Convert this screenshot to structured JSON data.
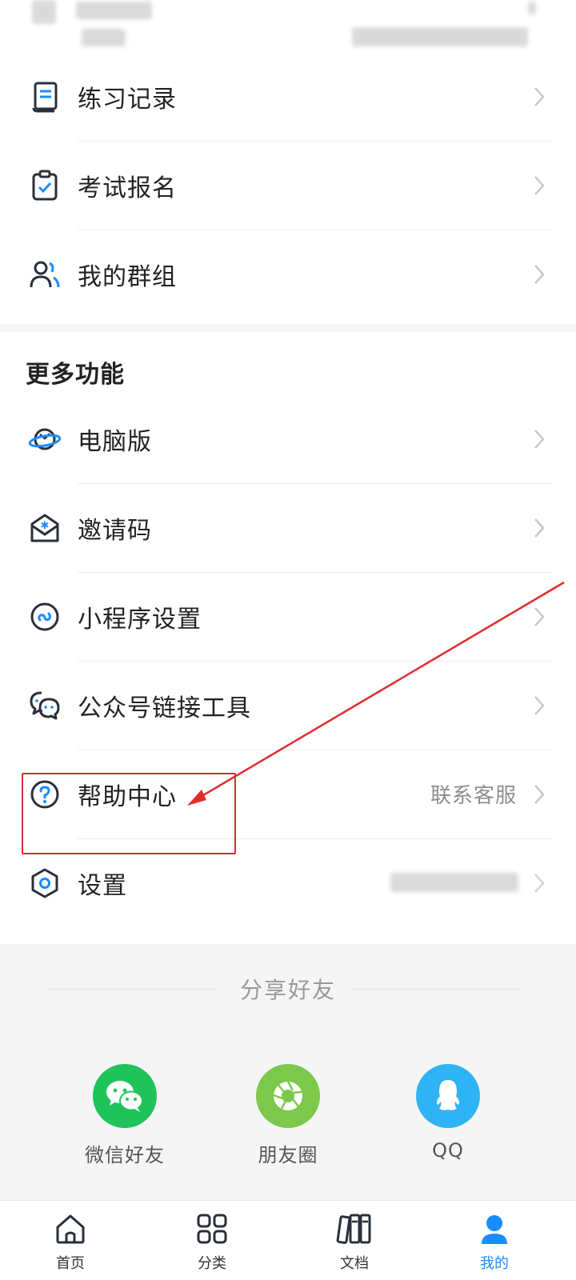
{
  "top_strip": {
    "note_hidden": ""
  },
  "menu_top": [
    {
      "name": "practice-records",
      "label": "练习记录",
      "icon": "document-icon"
    },
    {
      "name": "exam-registration",
      "label": "考试报名",
      "icon": "clipboard-check-icon"
    },
    {
      "name": "my-groups",
      "label": "我的群组",
      "icon": "group-icon"
    }
  ],
  "more_section": {
    "title": "更多功能",
    "items": [
      {
        "name": "desktop-version",
        "label": "电脑版",
        "icon": "planet-icon",
        "extra": ""
      },
      {
        "name": "invite-code",
        "label": "邀请码",
        "icon": "envelope-star-icon",
        "extra": ""
      },
      {
        "name": "mini-program-settings",
        "label": "小程序设置",
        "icon": "mini-program-icon",
        "extra": ""
      },
      {
        "name": "official-account-link-tool",
        "label": "公众号链接工具",
        "icon": "chat-bubbles-icon",
        "extra": ""
      },
      {
        "name": "help-center",
        "label": "帮助中心",
        "icon": "question-circle-icon",
        "extra": "联系客服"
      },
      {
        "name": "settings",
        "label": "设置",
        "icon": "hexagon-settings-icon",
        "extra": ""
      }
    ]
  },
  "share": {
    "title": "分享好友",
    "items": [
      {
        "name": "wechat-friends",
        "label": "微信好友",
        "color": "#1fc35a",
        "icon": "wechat-icon"
      },
      {
        "name": "moments",
        "label": "朋友圈",
        "color": "#7cc84b",
        "icon": "moments-aperture-icon"
      },
      {
        "name": "qq",
        "label": "QQ",
        "color": "#2eb3f5",
        "icon": "qq-penguin-icon"
      }
    ]
  },
  "tabbar": [
    {
      "name": "home",
      "label": "首页",
      "icon": "home-icon",
      "active": false
    },
    {
      "name": "category",
      "label": "分类",
      "icon": "grid-icon",
      "active": false
    },
    {
      "name": "documents",
      "label": "文档",
      "icon": "books-icon",
      "active": false
    },
    {
      "name": "mine",
      "label": "我的",
      "icon": "user-icon",
      "active": true
    }
  ],
  "colors": {
    "accent": "#1a8cff",
    "annotation": "#e02b2b"
  }
}
